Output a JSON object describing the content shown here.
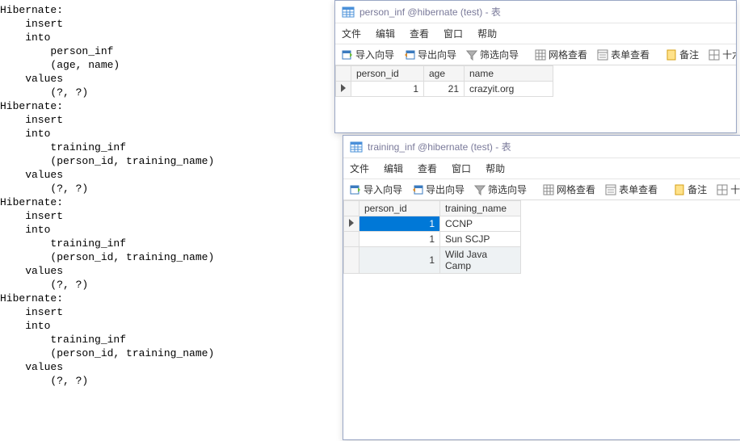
{
  "sql": {
    "blocks": [
      {
        "line1": "Hibernate:",
        "lines": [
          "    insert",
          "    into",
          "        person_inf",
          "        (age, name)",
          "    values",
          "        (?, ?)"
        ]
      },
      {
        "line1": "Hibernate:",
        "lines": [
          "    insert",
          "    into",
          "        training_inf",
          "        (person_id, training_name)",
          "    values",
          "        (?, ?)"
        ]
      },
      {
        "line1": "Hibernate:",
        "lines": [
          "    insert",
          "    into",
          "        training_inf",
          "        (person_id, training_name)",
          "    values",
          "        (?, ?)"
        ]
      },
      {
        "line1": "Hibernate:",
        "lines": [
          "    insert",
          "    into",
          "        training_inf",
          "        (person_id, training_name)",
          "    values",
          "        (?, ?)"
        ]
      }
    ]
  },
  "window1": {
    "title": "person_inf @hibernate (test) - 表",
    "menus": {
      "file": "文件",
      "edit": "编辑",
      "view": "查看",
      "window": "窗口",
      "help": "帮助"
    },
    "toolbar": {
      "import": "导入向导",
      "export": "导出向导",
      "filter": "筛选向导",
      "gridview": "网格查看",
      "formview": "表单查看",
      "note": "备注",
      "hex": "十六进"
    },
    "cols": {
      "c1": "person_id",
      "c2": "age",
      "c3": "name"
    },
    "rows": [
      {
        "person_id": "1",
        "age": "21",
        "name": "crazyit.org"
      }
    ]
  },
  "window2": {
    "title": "training_inf @hibernate (test) - 表",
    "menus": {
      "file": "文件",
      "edit": "编辑",
      "view": "查看",
      "window": "窗口",
      "help": "帮助"
    },
    "toolbar": {
      "import": "导入向导",
      "export": "导出向导",
      "filter": "筛选向导",
      "gridview": "网格查看",
      "formview": "表单查看",
      "note": "备注",
      "hex": "十六进"
    },
    "cols": {
      "c1": "person_id",
      "c2": "training_name"
    },
    "rows": [
      {
        "person_id": "1",
        "training_name": "CCNP"
      },
      {
        "person_id": "1",
        "training_name": "Sun SCJP"
      },
      {
        "person_id": "1",
        "training_name": "Wild Java Camp"
      }
    ]
  }
}
